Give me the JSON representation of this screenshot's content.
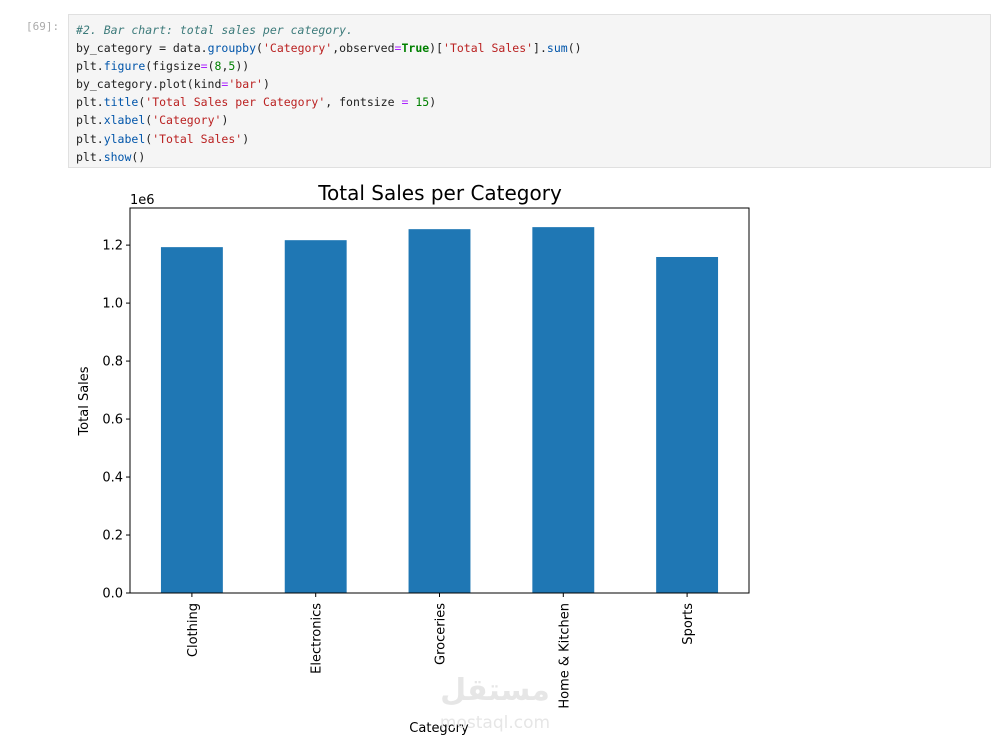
{
  "cell": {
    "prompt": "[69]:",
    "code": {
      "comment": "#2. Bar chart: total sales per category.",
      "l2a": "by_category = data.",
      "l2fn": "groupby",
      "l2b": "(",
      "l2s1": "'Category'",
      "l2c": ",observed",
      "l2eq": "=",
      "l2kw": "True",
      "l2d": ")[",
      "l2s2": "'Total Sales'",
      "l2e": "].",
      "l2fn2": "sum",
      "l2f": "()",
      "l3a": "plt.",
      "l3fn": "figure",
      "l3b": "(figsize",
      "l3eq": "=",
      "l3c": "(",
      "l3n1": "8",
      "l3d": ",",
      "l3n2": "5",
      "l3e": "))",
      "l4a": "by_category.plot(kind",
      "l4eq": "=",
      "l4s": "'bar'",
      "l4b": ")",
      "l5a": "plt.",
      "l5fn": "title",
      "l5b": "(",
      "l5s": "'Total Sales per Category'",
      "l5c": ", fontsize ",
      "l5eq": "=",
      "l5d": " ",
      "l5n": "15",
      "l5e": ")",
      "l6a": "plt.",
      "l6fn": "xlabel",
      "l6b": "(",
      "l6s": "'Category'",
      "l6c": ")",
      "l7a": "plt.",
      "l7fn": "ylabel",
      "l7b": "(",
      "l7s": "'Total Sales'",
      "l7c": ")",
      "l8a": "plt.",
      "l8fn": "show",
      "l8b": "()"
    }
  },
  "watermark": "مستقل mostaql.com",
  "chart_data": {
    "type": "bar",
    "title": "Total Sales per Category",
    "xlabel": "Category",
    "ylabel": "Total Sales",
    "offset_label": "1e6",
    "categories": [
      "Clothing",
      "Electronics",
      "Groceries",
      "Home & Kitchen",
      "Sports"
    ],
    "values": [
      1.193,
      1.217,
      1.255,
      1.262,
      1.159
    ],
    "value_scale": 1000000,
    "ylim": [
      0,
      1.328
    ],
    "yticks": [
      "0.0",
      "0.2",
      "0.4",
      "0.6",
      "0.8",
      "1.0",
      "1.2"
    ],
    "bar_color": "#1f77b4",
    "grid": false
  }
}
